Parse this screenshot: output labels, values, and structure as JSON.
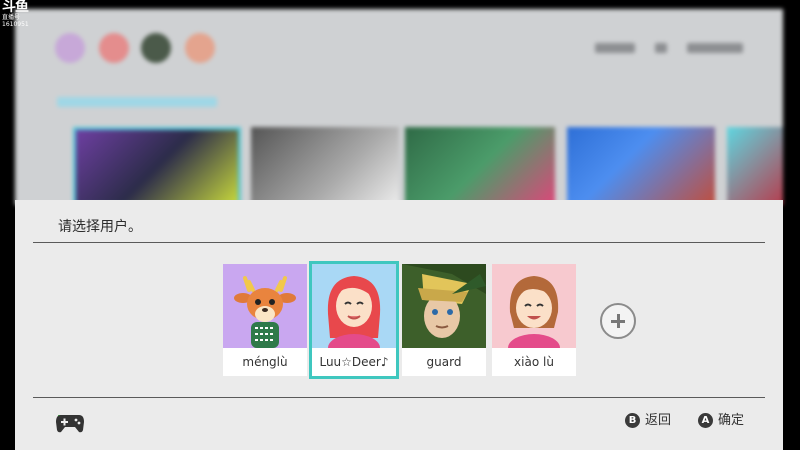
{
  "watermark": {
    "logo": "斗鱼",
    "line1": "直播号",
    "line2": "1610951"
  },
  "dialog": {
    "prompt": "请选择用户。",
    "users": [
      {
        "name": "ménglù",
        "avatar": "deer-villager-icon",
        "bg": "#c9a7f0"
      },
      {
        "name": "Luu☆Deer♪",
        "avatar": "mii-red-hair-icon",
        "bg": "#a9d8f5",
        "selected": true
      },
      {
        "name": "guard",
        "avatar": "link-character-icon",
        "bg": "#3d5f2a"
      },
      {
        "name": "xiào lù",
        "avatar": "mii-brown-hair-icon",
        "bg": "#f7c9cf"
      }
    ],
    "add_user_label": "+",
    "hints": {
      "back_button": "B",
      "back_label": "返回",
      "confirm_button": "A",
      "confirm_label": "确定"
    }
  },
  "colors": {
    "selection": "#3fc7bf",
    "dialog_bg": "#ebebeb"
  }
}
